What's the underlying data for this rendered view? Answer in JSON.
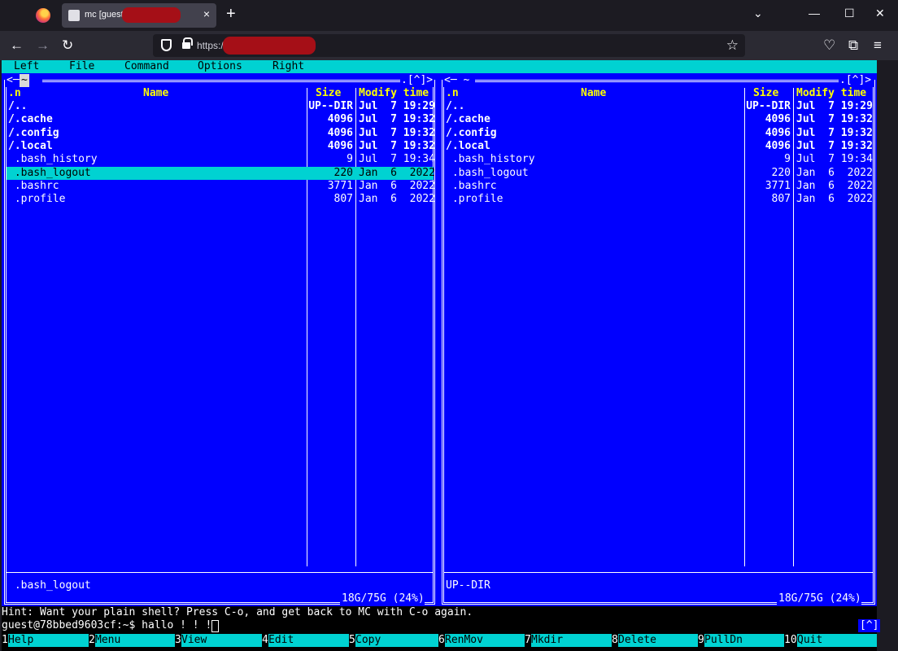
{
  "browser": {
    "tab_title": "mc [guest@",
    "tab_close": "×",
    "new_tab": "+",
    "url": "https://",
    "controls": {
      "list": "⌄",
      "minimize": "—",
      "maximize": "☐",
      "close": "✕"
    },
    "nav": {
      "back": "←",
      "forward": "→",
      "reload": "↻"
    },
    "toolbar": {
      "bookmark": "☆",
      "pocket": "♡",
      "extensions": "⧉",
      "menu": "≡"
    }
  },
  "mc": {
    "menu": [
      "Left",
      "File",
      "Command",
      "Options",
      "Right"
    ],
    "left_panel": {
      "title_prefix": "<─",
      "dir": "~",
      "title_suffix": ".[^]>",
      "headers": {
        "sort": ".n",
        "name": "Name",
        "size": "Size",
        "modify": "Modify time"
      },
      "rows": [
        {
          "name": "/..",
          "size": "UP--DIR",
          "date": "Jul  7 19:29",
          "dir": true
        },
        {
          "name": "/.cache",
          "size": "4096",
          "date": "Jul  7 19:32",
          "dir": true
        },
        {
          "name": "/.config",
          "size": "4096",
          "date": "Jul  7 19:32",
          "dir": true
        },
        {
          "name": "/.local",
          "size": "4096",
          "date": "Jul  7 19:32",
          "dir": true
        },
        {
          "name": " .bash_history",
          "size": "9",
          "date": "Jul  7 19:34",
          "dir": false
        },
        {
          "name": " .bash_logout",
          "size": "220",
          "date": "Jan  6  2022",
          "dir": false,
          "selected": true
        },
        {
          "name": " .bashrc",
          "size": "3771",
          "date": "Jan  6  2022",
          "dir": false
        },
        {
          "name": " .profile",
          "size": "807",
          "date": "Jan  6  2022",
          "dir": false
        }
      ],
      "status": " .bash_logout",
      "disk": "18G/75G (24%)"
    },
    "right_panel": {
      "title_prefix": "<─ ~",
      "title_suffix": ".[^]>",
      "headers": {
        "sort": ".n",
        "name": "Name",
        "size": "Size",
        "modify": "Modify time"
      },
      "rows": [
        {
          "name": "/..",
          "size": "UP--DIR",
          "date": "Jul  7 19:29",
          "dir": true
        },
        {
          "name": "/.cache",
          "size": "4096",
          "date": "Jul  7 19:32",
          "dir": true
        },
        {
          "name": "/.config",
          "size": "4096",
          "date": "Jul  7 19:32",
          "dir": true
        },
        {
          "name": "/.local",
          "size": "4096",
          "date": "Jul  7 19:32",
          "dir": true
        },
        {
          "name": " .bash_history",
          "size": "9",
          "date": "Jul  7 19:34",
          "dir": false
        },
        {
          "name": " .bash_logout",
          "size": "220",
          "date": "Jan  6  2022",
          "dir": false
        },
        {
          "name": " .bashrc",
          "size": "3771",
          "date": "Jan  6  2022",
          "dir": false
        },
        {
          "name": " .profile",
          "size": "807",
          "date": "Jan  6  2022",
          "dir": false
        }
      ],
      "status": "UP--DIR",
      "disk": "18G/75G (24%)"
    },
    "hint": "Hint: Want your plain shell? Press C-o, and get back to MC with C-o again.",
    "prompt": "guest@78bbed9603cf:~$ hallo ! ! !",
    "prompt_badge": "[^]",
    "fkeys": [
      {
        "num": "1",
        "label": "Help"
      },
      {
        "num": "2",
        "label": "Menu"
      },
      {
        "num": "3",
        "label": "View"
      },
      {
        "num": "4",
        "label": "Edit"
      },
      {
        "num": "5",
        "label": "Copy"
      },
      {
        "num": "6",
        "label": "RenMov"
      },
      {
        "num": "7",
        "label": "Mkdir"
      },
      {
        "num": "8",
        "label": "Delete"
      },
      {
        "num": "9",
        "label": "PullDn"
      },
      {
        "num": "10",
        "label": "Quit"
      }
    ],
    "colors": {
      "panel_bg": "#0000ff",
      "bar_bg": "#00d2d2",
      "header": "#ffff00"
    }
  }
}
